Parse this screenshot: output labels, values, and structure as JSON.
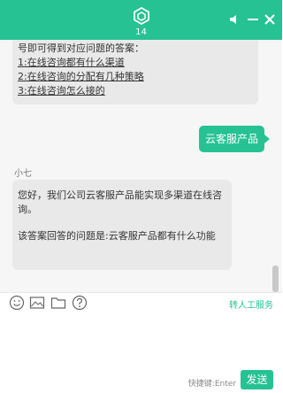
{
  "header": {
    "count": "14"
  },
  "messages": {
    "first": {
      "intro": "号即可得到对应问题的答案：",
      "links": [
        "1:在线咨询都有什么渠道",
        "2:在线咨询的分配有几种策略",
        "3:在线咨询怎么接的"
      ]
    },
    "user_reply": "云客服产品",
    "sender": "小七",
    "answer": {
      "para1": "您好，我们公司云客服产品能实现多渠道在线咨询。",
      "para2": "该答案回答的问题是:云客服产品都有什么功能"
    }
  },
  "toolbar": {
    "icons": [
      "emoji-icon",
      "image-icon",
      "folder-icon",
      "help-icon"
    ],
    "transfer_label": "转人工服务"
  },
  "composer": {
    "shortcut_hint": "快捷键:Enter",
    "send_label": "发送"
  },
  "colors": {
    "accent": "#26c294",
    "bubble": "#e9e9e9",
    "chat_bg": "#f6f6f6"
  }
}
